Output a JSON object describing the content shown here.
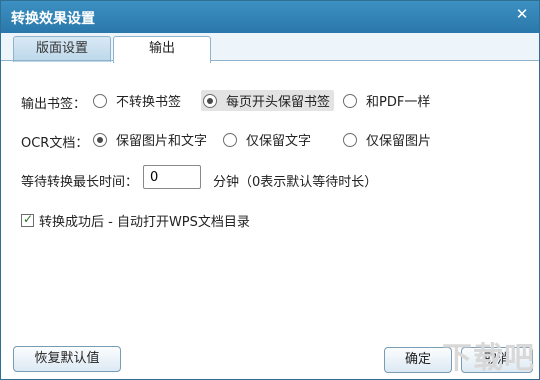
{
  "window": {
    "title": "转换效果设置",
    "close_symbol": "✕"
  },
  "tabs": [
    {
      "label": "版面设置",
      "active": false
    },
    {
      "label": "输出",
      "active": true
    }
  ],
  "bookmark": {
    "label": "输出书签：",
    "options": [
      {
        "label": "不转换书签",
        "checked": false
      },
      {
        "label": "每页开头保留书签",
        "checked": true
      },
      {
        "label": "和PDF一样",
        "checked": false
      }
    ]
  },
  "ocr": {
    "label": "OCR文档：",
    "options": [
      {
        "label": "保留图片和文字",
        "checked": true
      },
      {
        "label": "仅保留文字",
        "checked": false
      },
      {
        "label": "仅保留图片",
        "checked": false
      }
    ]
  },
  "wait": {
    "label": "等待转换最长时间：",
    "value": "0",
    "unit_note": "分钟（0表示默认等待时长）"
  },
  "auto_open": {
    "label": "转换成功后 - 自动打开WPS文档目录",
    "checked": true
  },
  "buttons": {
    "restore": "恢复默认值",
    "ok": "确定",
    "cancel": "取消"
  },
  "watermark": "下载吧"
}
